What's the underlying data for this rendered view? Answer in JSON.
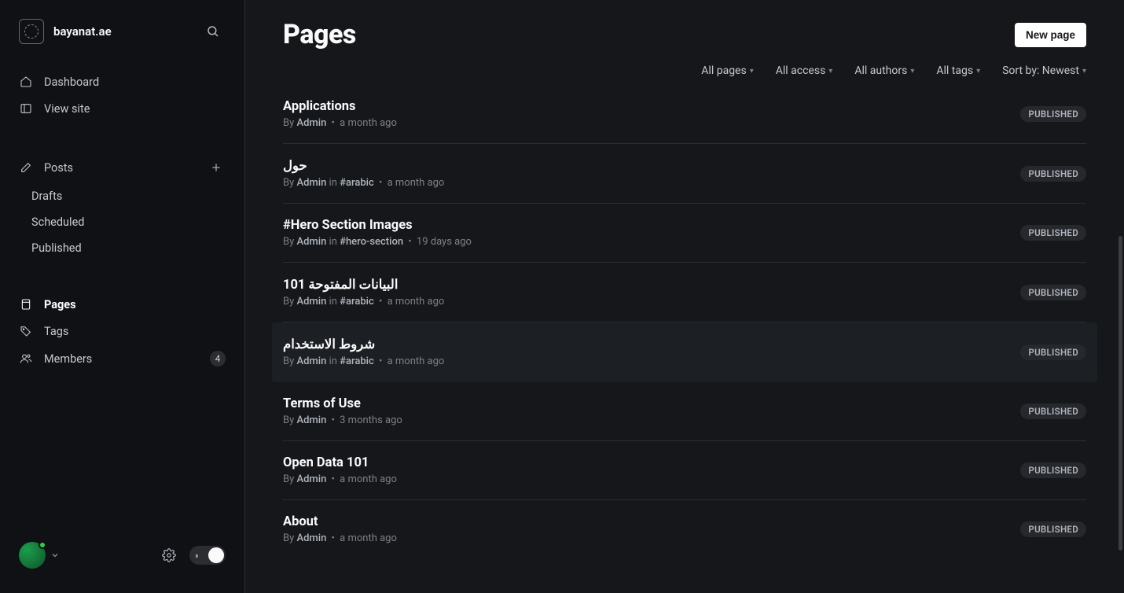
{
  "site": {
    "name": "bayanat.ae"
  },
  "sidebar": {
    "nav_primary": [
      {
        "label": "Dashboard",
        "icon": "home-icon"
      },
      {
        "label": "View site",
        "icon": "layout-icon"
      }
    ],
    "posts": {
      "label": "Posts",
      "sub": [
        {
          "label": "Drafts"
        },
        {
          "label": "Scheduled"
        },
        {
          "label": "Published"
        }
      ]
    },
    "nav_secondary": [
      {
        "label": "Pages",
        "icon": "file-icon",
        "active": true
      },
      {
        "label": "Tags",
        "icon": "tag-icon"
      },
      {
        "label": "Members",
        "icon": "users-icon",
        "count": "4"
      }
    ]
  },
  "header": {
    "title": "Pages",
    "new_page": "New page"
  },
  "filters": {
    "pages": "All pages",
    "access": "All access",
    "authors": "All authors",
    "tags": "All tags",
    "sort": "Sort by: Newest"
  },
  "status_labels": {
    "published": "PUBLISHED"
  },
  "meta_labels": {
    "by": "By",
    "in": "in"
  },
  "pages": [
    {
      "title": "Applications",
      "author": "Admin",
      "tag": null,
      "time": "a month ago",
      "status": "PUBLISHED"
    },
    {
      "title": "حول",
      "author": "Admin",
      "tag": "#arabic",
      "time": "a month ago",
      "status": "PUBLISHED"
    },
    {
      "title": "#Hero Section Images",
      "author": "Admin",
      "tag": "#hero-section",
      "time": "19 days ago",
      "status": "PUBLISHED"
    },
    {
      "title": "البيانات المفتوحة 101",
      "author": "Admin",
      "tag": "#arabic",
      "time": "a month ago",
      "status": "PUBLISHED"
    },
    {
      "title": "شروط الاستخدام",
      "author": "Admin",
      "tag": "#arabic",
      "time": "a month ago",
      "status": "PUBLISHED",
      "hovered": true
    },
    {
      "title": "Terms of Use",
      "author": "Admin",
      "tag": null,
      "time": "3 months ago",
      "status": "PUBLISHED"
    },
    {
      "title": "Open Data 101",
      "author": "Admin",
      "tag": null,
      "time": "a month ago",
      "status": "PUBLISHED"
    },
    {
      "title": "About",
      "author": "Admin",
      "tag": null,
      "time": "a month ago",
      "status": "PUBLISHED"
    }
  ]
}
